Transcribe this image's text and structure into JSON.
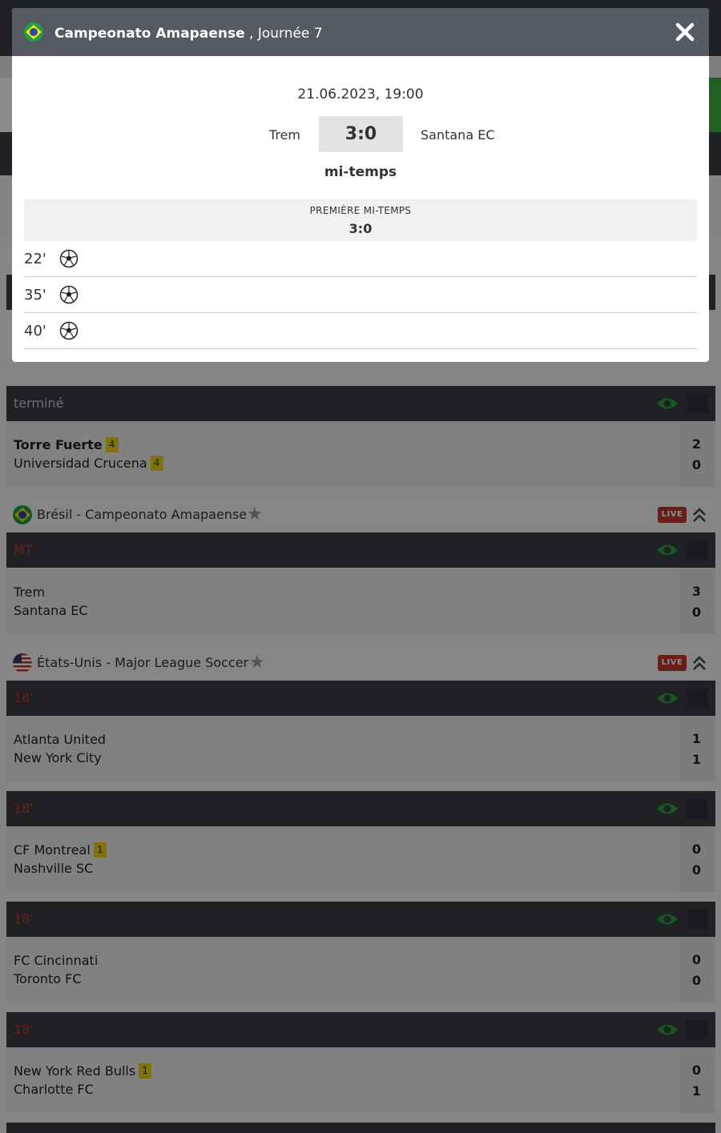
{
  "modal": {
    "league_name": "Campeonato Amapaense",
    "round": ", Journée 7",
    "date_time": "21.06.2023, 19:00",
    "home_team": "Trem",
    "away_team": "Santana EC",
    "score": "3:0",
    "status": "mi-temps",
    "half_label": "PREMIÈRE MI-TEMPS",
    "half_score": "3:0",
    "events": [
      {
        "minute": "22'",
        "icon": "soccer-ball-icon"
      },
      {
        "minute": "35'",
        "icon": "soccer-ball-icon"
      },
      {
        "minute": "40'",
        "icon": "soccer-ball-icon"
      }
    ]
  },
  "background": {
    "matches": [
      {
        "status": "terminé",
        "home": "Torre Fuerte",
        "home_card": "4",
        "away": "Universidad Crucena",
        "away_card": "4",
        "home_score": "2",
        "away_score": "0"
      },
      {
        "status": "MT",
        "home": "Trem",
        "away": "Santana EC",
        "home_score": "3",
        "away_score": "0"
      },
      {
        "status": "18'",
        "home": "Atlanta United",
        "away": "New York City",
        "home_score": "1",
        "away_score": "1"
      },
      {
        "status": "18'",
        "home": "CF Montreal",
        "home_card": "1",
        "away": "Nashville SC",
        "home_score": "0",
        "away_score": "0"
      },
      {
        "status": "18'",
        "home": "FC Cincinnati",
        "away": "Toronto FC",
        "home_score": "0",
        "away_score": "0"
      },
      {
        "status": "18'",
        "home": "New York Red Bulls",
        "home_card": "1",
        "away": "Charlotte FC",
        "home_score": "0",
        "away_score": "1"
      }
    ],
    "leagues": [
      {
        "name": "Brésil - Campeonato Amapaense",
        "live": "LIVE"
      },
      {
        "name": "États-Unis - Major League Soccer",
        "live": "LIVE"
      }
    ]
  },
  "colors": {
    "header_dark": "#3a3d44",
    "modal_header": "#555a63",
    "live_red": "#c0392b",
    "eye_green": "#2e9e3a",
    "card_yellow": "#e8d21d"
  }
}
